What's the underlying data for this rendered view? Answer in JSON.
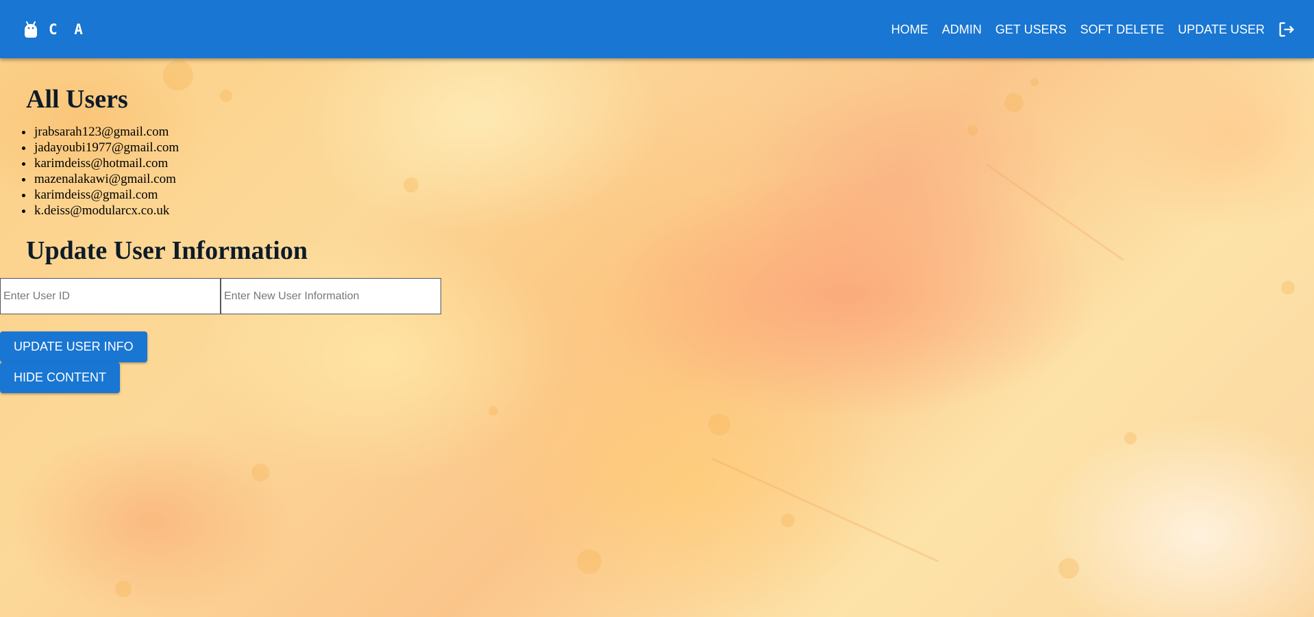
{
  "appbar": {
    "brand_text": "C A",
    "brand_icon": "android-icon",
    "nav": [
      "HOME",
      "ADMIN",
      "GET USERS",
      "SOFT DELETE",
      "UPDATE USER"
    ],
    "logout_icon": "logout-icon",
    "color": "#1976d2"
  },
  "users": {
    "title": "All Users",
    "emails": [
      "jrabsarah123@gmail.com",
      "jadayoubi1977@gmail.com",
      "karimdeiss@hotmail.com",
      "mazenalakawi@gmail.com",
      "karimdeiss@gmail.com",
      "k.deiss@modularcx.co.uk"
    ]
  },
  "update": {
    "title": "Update User Information",
    "user_id_placeholder": "Enter User ID",
    "user_id_value": "",
    "info_placeholder": "Enter New User Information",
    "info_value": "",
    "update_button": "UPDATE USER INFO",
    "hide_button": "HIDE CONTENT"
  }
}
